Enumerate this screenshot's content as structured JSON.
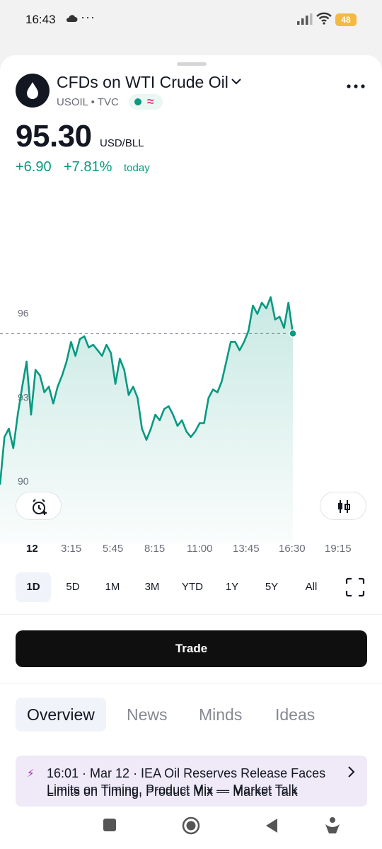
{
  "status_bar": {
    "time": "16:43",
    "dots": "···",
    "battery": "48"
  },
  "header": {
    "title": "CFDs on WTI Crude Oil",
    "symbol": "USOIL",
    "separator": "•",
    "exchange": "TVC",
    "delayed_icon": "≈"
  },
  "quote": {
    "price": "95.30",
    "currency": "USD/BLL",
    "change_abs": "+6.90",
    "change_pct": "+7.81%",
    "change_label": "today"
  },
  "chart_data": {
    "type": "area",
    "symbol": "USOIL",
    "y_ticks": [
      "96",
      "93",
      "90"
    ],
    "x_ticks": [
      "12",
      "3:15",
      "5:45",
      "8:15",
      "11:00",
      "13:45",
      "16:30",
      "19:15"
    ],
    "ylim": [
      87.8,
      98.8
    ],
    "last_value": 95.3,
    "line_color": "#089981",
    "x": [
      "00:00",
      "00:15",
      "00:30",
      "00:45",
      "01:00",
      "01:15",
      "01:30",
      "01:45",
      "02:00",
      "02:15",
      "02:30",
      "02:45",
      "03:00",
      "03:15",
      "03:30",
      "03:45",
      "04:00",
      "04:15",
      "04:30",
      "04:45",
      "05:00",
      "05:15",
      "05:30",
      "05:45",
      "06:00",
      "06:15",
      "06:30",
      "06:45",
      "07:00",
      "07:15",
      "07:30",
      "07:45",
      "08:00",
      "08:15",
      "08:30",
      "08:45",
      "09:00",
      "09:15",
      "09:30",
      "09:45",
      "10:00",
      "10:15",
      "10:30",
      "10:45",
      "11:00",
      "11:15",
      "11:30",
      "11:45",
      "12:00",
      "12:15",
      "12:30",
      "12:45",
      "13:00",
      "13:15",
      "13:30",
      "13:45",
      "14:00",
      "14:15",
      "14:30",
      "14:45",
      "15:00",
      "15:15",
      "15:30",
      "15:45",
      "16:00",
      "16:15",
      "16:30"
    ],
    "values": [
      89.9,
      91.6,
      91.9,
      91.2,
      92.4,
      93.4,
      94.3,
      92.4,
      94.0,
      93.8,
      93.2,
      93.4,
      92.8,
      93.4,
      93.8,
      94.3,
      95.0,
      94.5,
      95.1,
      95.2,
      94.8,
      94.9,
      94.7,
      94.5,
      94.9,
      94.6,
      93.5,
      94.4,
      94.0,
      93.1,
      93.4,
      93.0,
      91.9,
      91.5,
      91.9,
      92.4,
      92.2,
      92.6,
      92.7,
      92.4,
      92.0,
      92.2,
      91.8,
      91.6,
      91.8,
      92.1,
      92.1,
      93.0,
      93.3,
      93.2,
      93.6,
      94.3,
      95.0,
      95.0,
      94.7,
      95.0,
      95.4,
      96.3,
      96.0,
      96.4,
      96.2,
      96.6,
      95.8,
      95.9,
      95.5,
      96.4,
      95.3
    ]
  },
  "time_ranges": [
    "1D",
    "5D",
    "1M",
    "3M",
    "YTD",
    "1Y",
    "5Y",
    "All"
  ],
  "trade_label": "Trade",
  "tabs": [
    "Overview",
    "News",
    "Minds",
    "Ideas"
  ],
  "news": {
    "headline": "16:01 · Mar 12 · IEA Oil Reserves Release Faces Limits on Timing, Product Mix — Market Talk",
    "peek": "Limits on Timing, Product Mix — Market Talk"
  },
  "icons": {
    "logo": "oil-drop-icon",
    "alert": "add-alarm-icon",
    "chart_style": "candlestick-icon",
    "fullscreen": "fullscreen-icon",
    "more": "more-dots-icon"
  }
}
